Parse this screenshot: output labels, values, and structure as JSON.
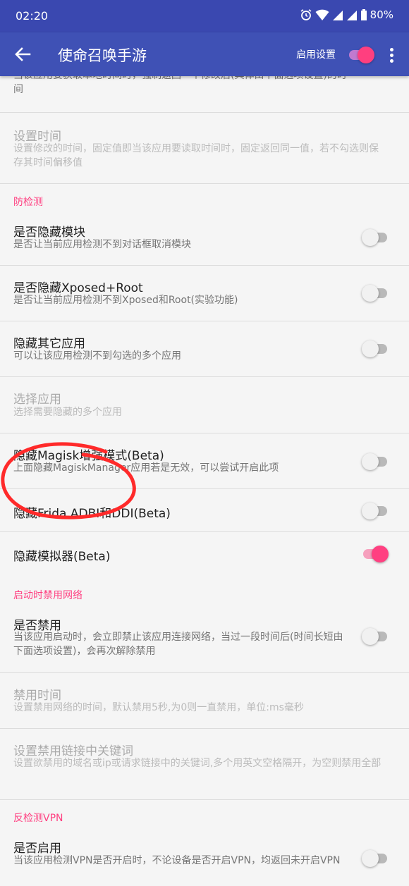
{
  "status_bar": {
    "time": "02:20",
    "battery": "80%"
  },
  "app_bar": {
    "title": "使命召唤手游",
    "enable_label": "启用设置",
    "enabled": true
  },
  "partial_item": {
    "subtitle": "当该应用要获取本地时间时，强制返回一个修改后(具体由下面选项设置)的时间",
    "enabled": false
  },
  "set_time": {
    "title": "设置时间",
    "subtitle": "设置修改的时间，固定值即当该应用要读取时间时，固定返回同一值，若不勾选则保存其时间偏移值"
  },
  "anti_detect": {
    "header": "防检测",
    "items": [
      {
        "title": "是否隐藏模块",
        "subtitle": "是否让当前应用检测不到对话框取消模块",
        "enabled": false
      },
      {
        "title": "是否隐藏Xposed+Root",
        "subtitle": "是否让当前应用检测不到Xposed和Root(实验功能)",
        "enabled": false
      },
      {
        "title": "隐藏其它应用",
        "subtitle": "可以让该应用检测不到勾选的多个应用",
        "enabled": false
      }
    ],
    "select_apps": {
      "title": "选择应用",
      "subtitle": "选择需要隐藏的多个应用"
    },
    "magisk": {
      "title": "隐藏Magisk增强模式(Beta)",
      "subtitle": "上面隐藏MagiskManager应用若是无效，可以尝试开启此项",
      "enabled": false
    },
    "frida": {
      "title": "隐藏Frida,ADBI和DDI(Beta)",
      "enabled": false
    },
    "emulator": {
      "title": "隐藏模拟器(Beta)",
      "enabled": true
    }
  },
  "network_block": {
    "header": "启动时禁用网络",
    "disable": {
      "title": "是否禁用",
      "subtitle": "当该应用启动时，会立即禁止该应用连接网络，当过一段时间后(时间长短由下面选项设置)，会再次解除禁用",
      "enabled": false
    },
    "duration": {
      "title": "禁用时间",
      "subtitle": "设置禁用网络的时间，默认禁用5秒,为0则一直禁用，单位:ms毫秒"
    },
    "keywords": {
      "title": "设置禁用链接中关键词",
      "subtitle": "设置欲禁用的域名或ip或请求链接中的关键词,多个用英文空格隔开，为空则禁用全部"
    }
  },
  "anti_vpn": {
    "header": "反检测VPN",
    "enable": {
      "title": "是否启用",
      "subtitle": "当该应用检测VPN是否开启时，不论设备是否开启VPN，均返回未开启VPN",
      "enabled": false
    }
  },
  "colors": {
    "primary": "#3f51b5",
    "primary_dark": "#3a48b0",
    "accent": "#ff4081",
    "annotation": "#ff2a2a"
  }
}
